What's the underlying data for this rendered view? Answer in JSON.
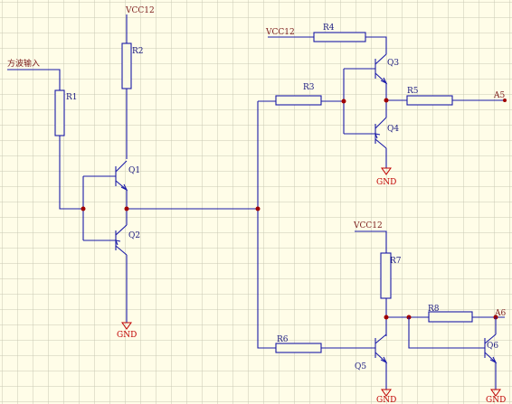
{
  "input_label": "方波输入",
  "net_labels": {
    "vcc_top": "VCC12",
    "vcc_r4": "VCC12",
    "vcc_r7": "VCC12",
    "gnd_q2": "GND",
    "gnd_q4": "GND",
    "gnd_q5": "GND",
    "gnd_q6": "GND",
    "out_a5": "A5",
    "out_a6": "A6"
  },
  "resistors": {
    "r1": "R1",
    "r2": "R2",
    "r3": "R3",
    "r4": "R4",
    "r5": "R5",
    "r6": "R6",
    "r7": "R7",
    "r8": "R8"
  },
  "transistors": {
    "q1": "Q1",
    "q2": "Q2",
    "q3": "Q3",
    "q4": "Q4",
    "q5": "Q5",
    "q6": "Q6"
  },
  "colors": {
    "background": "#fffde8",
    "grid": "#c9c9b4",
    "wire": "#1a1aa8",
    "junction": "#a00000",
    "ground": "#c00000"
  }
}
